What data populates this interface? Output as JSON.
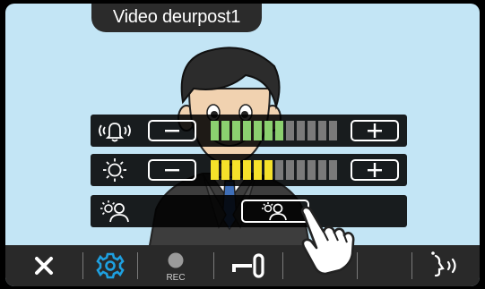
{
  "window": {
    "title": "Video deurpost1"
  },
  "controls": {
    "volume": {
      "label": "",
      "level": 7,
      "max": 12,
      "minus_label": "−",
      "plus_label": "+",
      "active_color": "#8bd06f",
      "inactive_color": "#7a7a7a",
      "icon": "bell-volume-icon"
    },
    "brightness": {
      "level": 6,
      "max": 12,
      "minus_label": "−",
      "plus_label": "+",
      "active_color": "#f5e12a",
      "inactive_color": "#7a7a7a",
      "icon": "sun-icon"
    },
    "backlight": {
      "icon": "backlight-person-icon",
      "toggle_icon": "backlight-person-icon"
    }
  },
  "toolbar": {
    "items": [
      {
        "name": "close",
        "icon": "close-icon"
      },
      {
        "name": "settings",
        "icon": "gear-icon",
        "color": "#1ea0e0"
      },
      {
        "name": "record",
        "icon": "record-icon",
        "label": "REC"
      },
      {
        "name": "unlock",
        "icon": "key-icon"
      },
      {
        "name": "empty1"
      },
      {
        "name": "empty2"
      },
      {
        "name": "talk",
        "icon": "talk-icon"
      }
    ]
  },
  "colors": {
    "screen_bg": "#c3e5f5",
    "panel_bg": "#111111",
    "toolbar_bg": "#292929",
    "accent": "#1ea0e0"
  }
}
